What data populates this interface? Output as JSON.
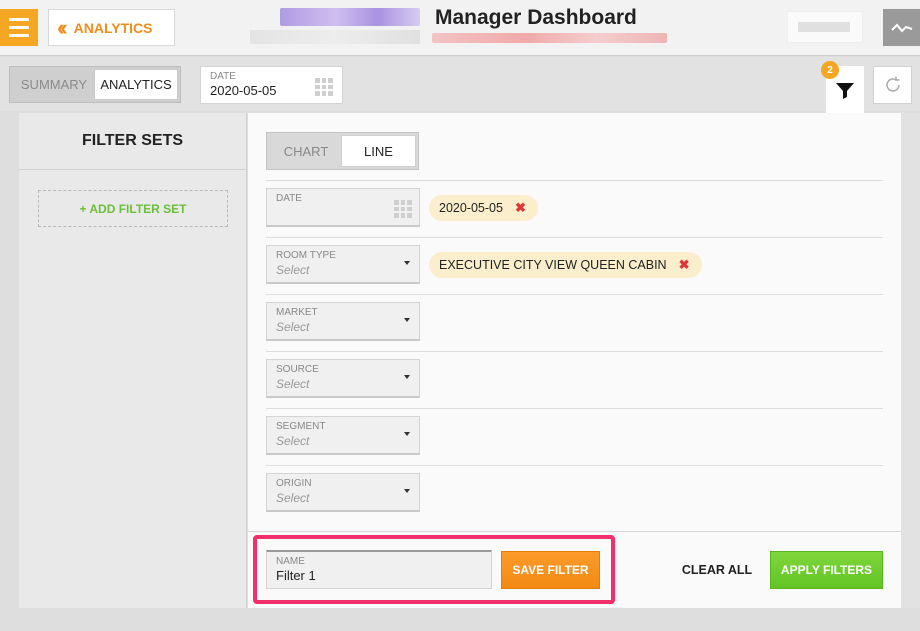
{
  "header": {
    "back_label": "ANALYTICS",
    "title": "Manager Dashboard"
  },
  "toolbar": {
    "tabs": [
      {
        "label": "SUMMARY",
        "active": false
      },
      {
        "label": "ANALYTICS",
        "active": true
      }
    ],
    "date_label": "DATE",
    "date_value": "2020-05-05",
    "filter_badge": "2"
  },
  "sidebar": {
    "heading": "FILTER SETS",
    "add_label": "+ ADD FILTER SET"
  },
  "view_toggle": [
    {
      "label": "CHART",
      "active": false
    },
    {
      "label": "LINE",
      "active": true
    }
  ],
  "filters": [
    {
      "label": "DATE",
      "placeholder": "",
      "chip": "2020-05-05",
      "type": "date"
    },
    {
      "label": "ROOM TYPE",
      "placeholder": "Select",
      "chip": "EXECUTIVE CITY VIEW QUEEN CABIN",
      "type": "select"
    },
    {
      "label": "MARKET",
      "placeholder": "Select",
      "type": "select"
    },
    {
      "label": "SOURCE",
      "placeholder": "Select",
      "type": "select"
    },
    {
      "label": "SEGMENT",
      "placeholder": "Select",
      "type": "select"
    },
    {
      "label": "ORIGIN",
      "placeholder": "Select",
      "type": "select"
    }
  ],
  "footer": {
    "name_label": "NAME",
    "name_value": "Filter 1",
    "save_label": "SAVE FILTER",
    "clear_label": "CLEAR ALL",
    "apply_label": "APPLY FILTERS"
  },
  "colors": {
    "accent_orange": "#f5a623",
    "apply_green": "#6cc92c",
    "highlight_pink": "#f0306a",
    "chip_bg": "#faeecd",
    "remove_red": "#e03636"
  }
}
